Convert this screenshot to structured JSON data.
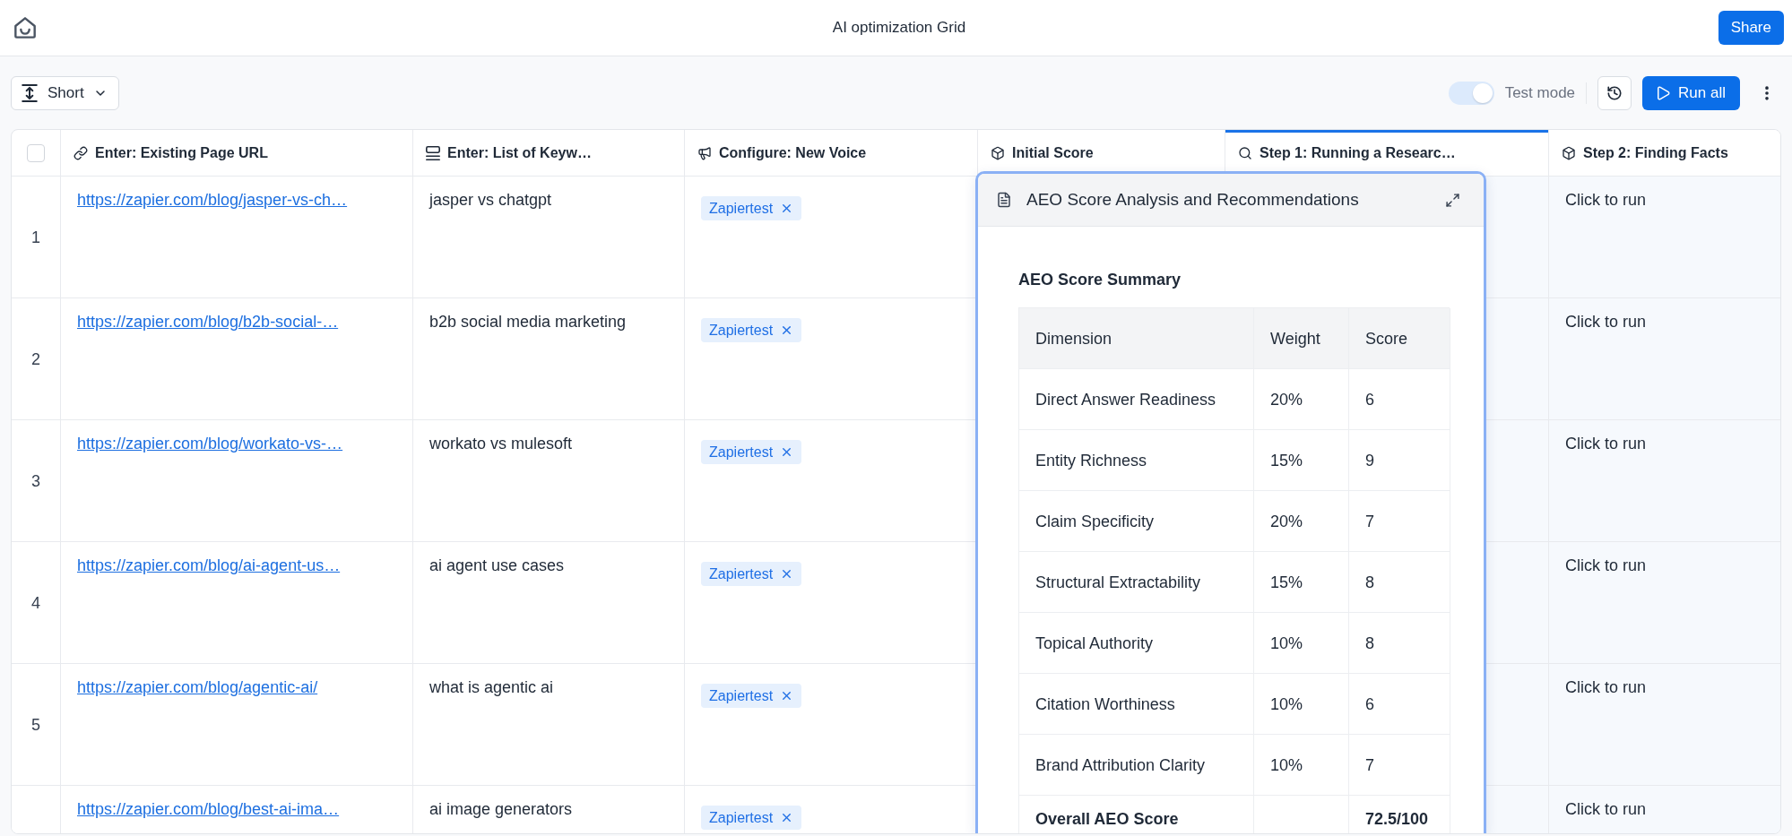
{
  "top_bar": {
    "title": "AI optimization Grid",
    "share_button": "Share"
  },
  "toolbar": {
    "row_height": "Short",
    "test_mode": {
      "label": "Test mode",
      "on": true
    },
    "run_button": "Run all"
  },
  "table": {
    "select_all": {
      "checked": false
    },
    "columns": [
      {
        "label": "Enter: Existing Page URL",
        "kind": "link",
        "selected": false
      },
      {
        "label": "Enter: List of Keyw…",
        "kind": "rows",
        "selected": false
      },
      {
        "label": "Configure: New Voice",
        "kind": "megaphone",
        "selected": false
      },
      {
        "label": "Initial Score",
        "kind": "cube",
        "selected": false
      },
      {
        "label": "Step 1: Running a Researc…",
        "kind": "search",
        "selected": true
      },
      {
        "label": "Step 2: Finding Facts",
        "kind": "cube",
        "selected": false
      }
    ],
    "rows": [
      {
        "number": "1",
        "url": "https://zapier.com/blog/jasper-vs-ch…",
        "keywords": "jasper vs chatgpt",
        "voice_tags": [
          "Zapiertest"
        ],
        "step_2": "Click to run"
      },
      {
        "number": "2",
        "url": "https://zapier.com/blog/b2b-social-…",
        "keywords": "b2b social media marketing",
        "voice_tags": [
          "Zapiertest"
        ],
        "step_2": "Click to run"
      },
      {
        "number": "3",
        "url": "https://zapier.com/blog/workato-vs-…",
        "keywords": "workato vs mulesoft",
        "voice_tags": [
          "Zapiertest"
        ],
        "step_2": "Click to run"
      },
      {
        "number": "4",
        "url": "https://zapier.com/blog/ai-agent-us…",
        "keywords": "ai agent use cases",
        "voice_tags": [
          "Zapiertest"
        ],
        "step_2": "Click to run"
      },
      {
        "number": "5",
        "url": "https://zapier.com/blog/agentic-ai/",
        "keywords": "what is agentic ai",
        "voice_tags": [
          "Zapiertest"
        ],
        "step_2": "Click to run"
      },
      {
        "url": "https://zapier.com/blog/best-ai-ima…",
        "keywords": "ai image generators",
        "voice_tags": [
          "Zapiertest"
        ],
        "step_2": "Click to run"
      }
    ]
  },
  "popup": {
    "title": "AEO Score Analysis and Recommendations",
    "heading": "AEO Score Summary",
    "columns": [
      "Dimension",
      "Weight",
      "Score"
    ],
    "rows": [
      {
        "dimension": "Direct Answer Readiness",
        "weight": "20%",
        "score": "6"
      },
      {
        "dimension": "Entity Richness",
        "weight": "15%",
        "score": "9"
      },
      {
        "dimension": "Claim Specificity",
        "weight": "20%",
        "score": "7"
      },
      {
        "dimension": "Structural Extractability",
        "weight": "15%",
        "score": "8"
      },
      {
        "dimension": "Topical Authority",
        "weight": "10%",
        "score": "8"
      },
      {
        "dimension": "Citation Worthiness",
        "weight": "10%",
        "score": "6"
      },
      {
        "dimension": "Brand Attribution Clarity",
        "weight": "10%",
        "score": "7"
      }
    ],
    "total": {
      "label": "Overall AEO Score",
      "score": "72.5/100"
    }
  }
}
